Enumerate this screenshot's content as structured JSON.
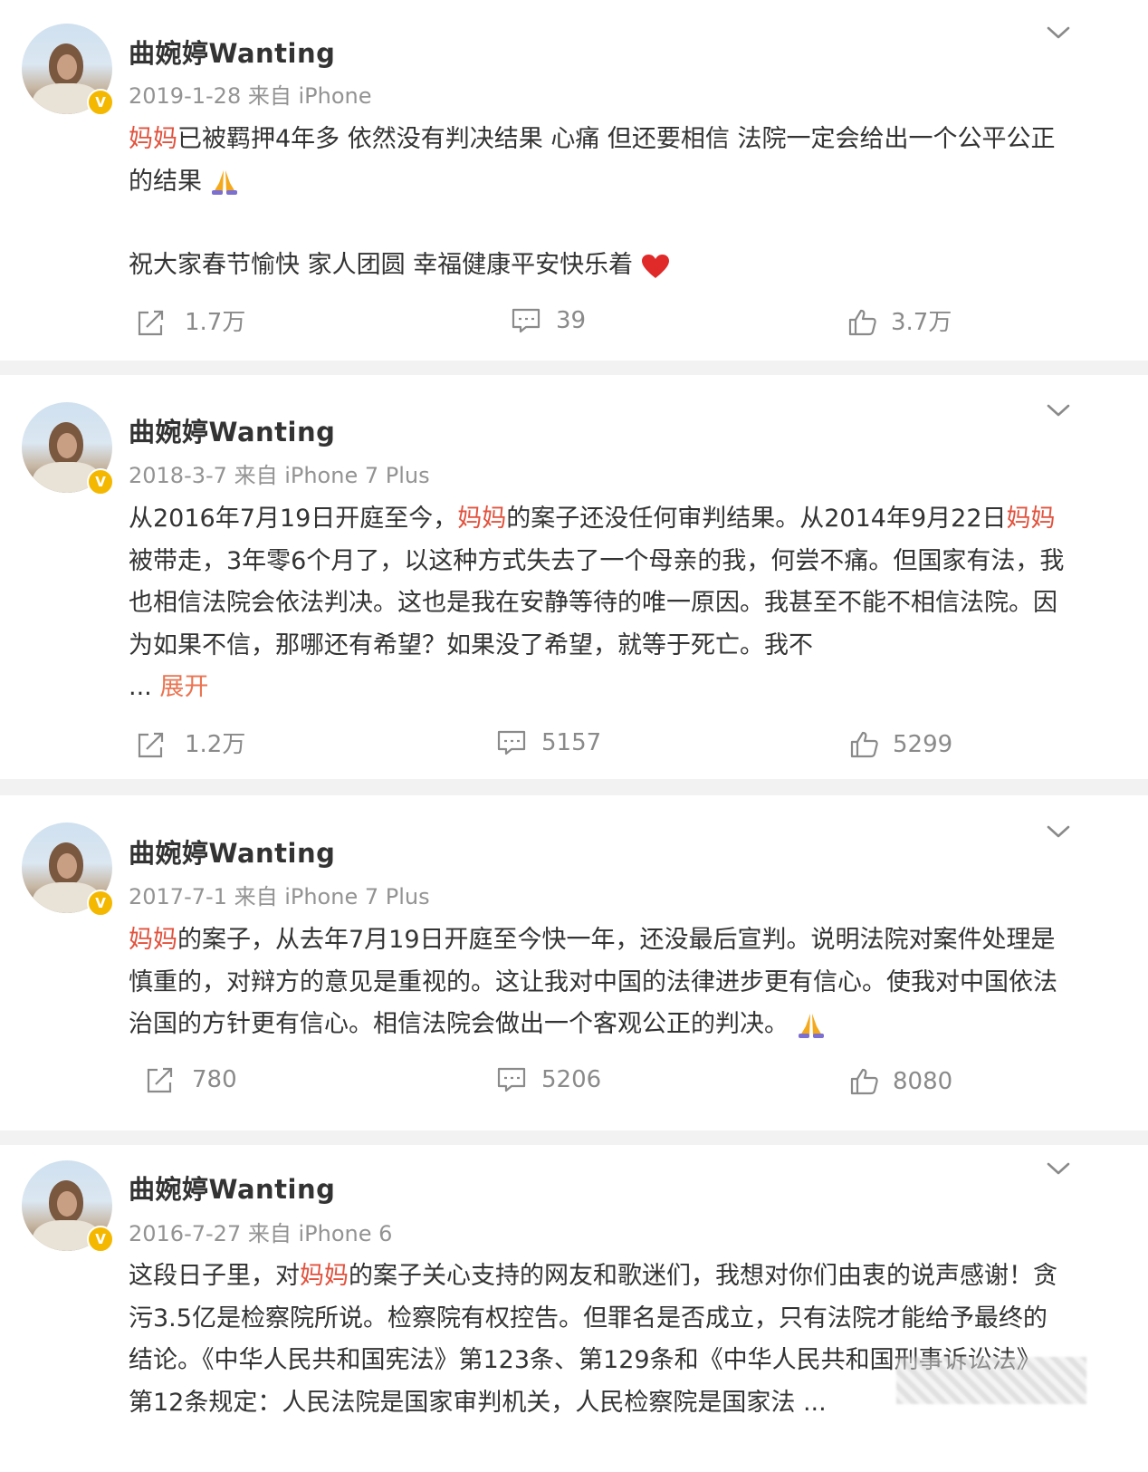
{
  "posts": [
    {
      "username": "曲婉婷Wanting",
      "date": "2019-1-28",
      "source": "来自 iPhone",
      "text_p1_hl": "妈妈",
      "text_p1": "已被羁押4年多 依然没有判决结果 心痛 但还要相信 法院一定会给出一个公平公正的结果",
      "text_p2": "祝大家春节愉快 家人团圆 幸福健康平安快乐着",
      "repost_count": "1.7万",
      "comment_count": "39",
      "like_count": "3.7万"
    },
    {
      "username": "曲婉婷Wanting",
      "date": "2018-3-7",
      "source": "来自 iPhone 7 Plus",
      "text_a": "从2016年7月19日开庭至今，",
      "text_hl1": "妈妈",
      "text_b": "的案子还没任何审判结果。从2014年9月22日",
      "text_hl2": "妈妈",
      "text_c": "被带走，3年零6个月了，以这种方式失去了一个母亲的我，何尝不痛。但国家有法，我也相信法院会依法判决。这也是我在安静等待的唯一原因。我甚至不能不相信法院。因为如果不信，那哪还有希望？如果没了希望，就等于死亡。我不",
      "ellipsis": "...",
      "expand_label": "展开",
      "repost_count": "1.2万",
      "comment_count": "5157",
      "like_count": "5299"
    },
    {
      "username": "曲婉婷Wanting",
      "date": "2017-7-1",
      "source": "来自 iPhone 7 Plus",
      "text_hl": "妈妈",
      "text": "的案子，从去年7月19日开庭至今快一年，还没最后宣判。说明法院对案件处理是慎重的，对辩方的意见是重视的。这让我对中国的法律进步更有信心。使我对中国依法治国的方针更有信心。相信法院会做出一个客观公正的判决。",
      "repost_count": "780",
      "comment_count": "5206",
      "like_count": "8080"
    },
    {
      "username": "曲婉婷Wanting",
      "date": "2016-7-27",
      "source": "来自 iPhone 6",
      "text_a": "这段日子里，对",
      "text_hl": "妈妈",
      "text_b": "的案子关心支持的网友和歌迷们，我想对你们由衷的说声感谢！贪污3.5亿是检察院所说。检察院有权控告。但罪名是否成立，只有法院才能给予最终的结论。《中华人民共和国宪法》第123条、第129条和《中华人民共和国刑事诉讼法》第12条规定：人民法院是国家审判机关，人民检察院是国家法",
      "ellipsis": "..."
    }
  ],
  "colors": {
    "highlight": "#e2523d",
    "expand": "#eb7350",
    "verified_badge": "#f5b800",
    "separator": "#f2f2f2"
  },
  "icons": [
    "chevron-down-icon",
    "repost-icon",
    "comment-icon",
    "like-icon",
    "verified-badge-icon",
    "praying-hands-emoji",
    "heart-emoji"
  ]
}
